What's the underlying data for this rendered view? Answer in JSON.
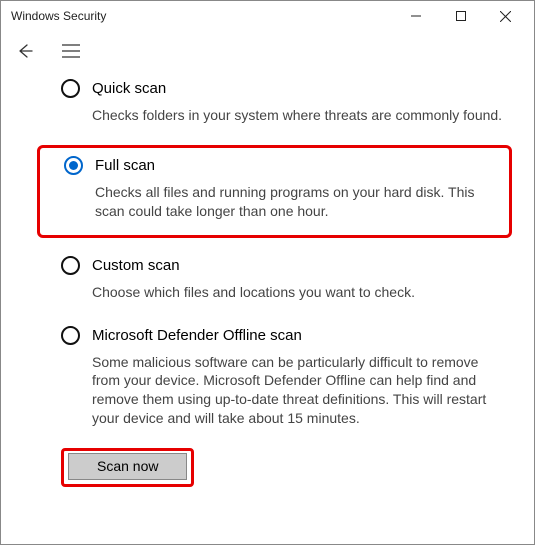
{
  "window": {
    "title": "Windows Security"
  },
  "options": [
    {
      "id": "quick",
      "title": "Quick scan",
      "desc": "Checks folders in your system where threats are commonly found.",
      "selected": false,
      "highlight": false
    },
    {
      "id": "full",
      "title": "Full scan",
      "desc": "Checks all files and running programs on your hard disk. This scan could take longer than one hour.",
      "selected": true,
      "highlight": true
    },
    {
      "id": "custom",
      "title": "Custom scan",
      "desc": "Choose which files and locations you want to check.",
      "selected": false,
      "highlight": false
    },
    {
      "id": "offline",
      "title": "Microsoft Defender Offline scan",
      "desc": "Some malicious software can be particularly difficult to remove from your device. Microsoft Defender Offline can help find and remove them using up-to-date threat definitions. This will restart your device and will take about 15 minutes.",
      "selected": false,
      "highlight": false
    }
  ],
  "actions": {
    "scan_now": "Scan now"
  }
}
